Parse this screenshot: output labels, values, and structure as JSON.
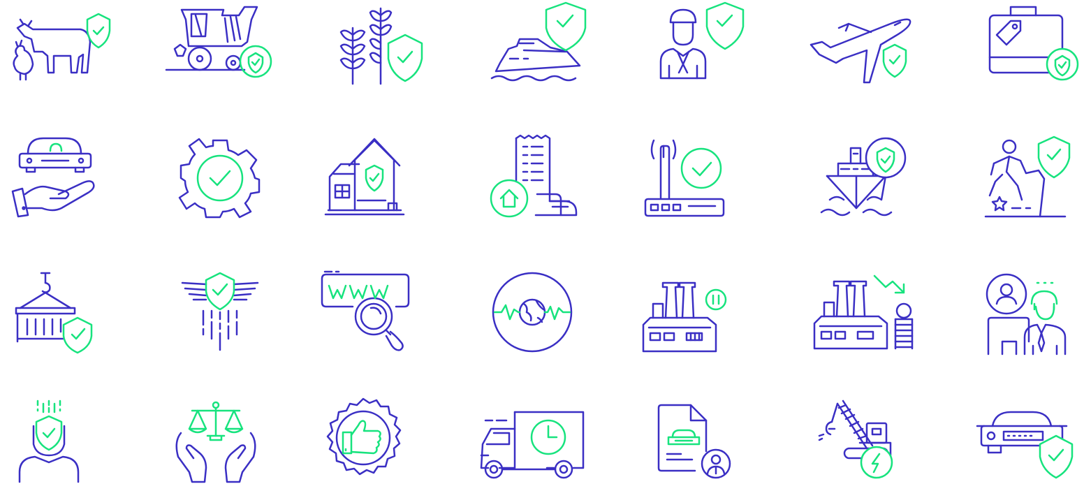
{
  "colors": {
    "primary": "#3a2fc4",
    "accent": "#17e37e",
    "background": "#ffffff"
  },
  "icons": [
    {
      "name": "livestock-insurance-icon"
    },
    {
      "name": "harvester-insurance-icon"
    },
    {
      "name": "crop-insurance-icon"
    },
    {
      "name": "yacht-insurance-icon"
    },
    {
      "name": "sailor-insurance-icon"
    },
    {
      "name": "airplane-insurance-icon"
    },
    {
      "name": "luggage-insurance-icon"
    },
    {
      "name": "car-in-hand-icon"
    },
    {
      "name": "gear-check-icon"
    },
    {
      "name": "home-insurance-icon"
    },
    {
      "name": "home-documents-icon"
    },
    {
      "name": "router-check-icon"
    },
    {
      "name": "cargo-ship-insurance-icon"
    },
    {
      "name": "slip-fall-injury-icon"
    },
    {
      "name": "container-insurance-icon"
    },
    {
      "name": "winged-shield-icon"
    },
    {
      "name": "www-search-icon"
    },
    {
      "name": "globe-pulse-icon"
    },
    {
      "name": "factory-pause-icon"
    },
    {
      "name": "factory-loss-icon"
    },
    {
      "name": "customer-support-icon"
    },
    {
      "name": "personal-protection-icon"
    },
    {
      "name": "legal-protection-icon"
    },
    {
      "name": "approval-badge-icon"
    },
    {
      "name": "delivery-truck-time-icon"
    },
    {
      "name": "car-document-icon"
    },
    {
      "name": "crane-machinery-icon"
    },
    {
      "name": "car-insurance-icon"
    }
  ]
}
